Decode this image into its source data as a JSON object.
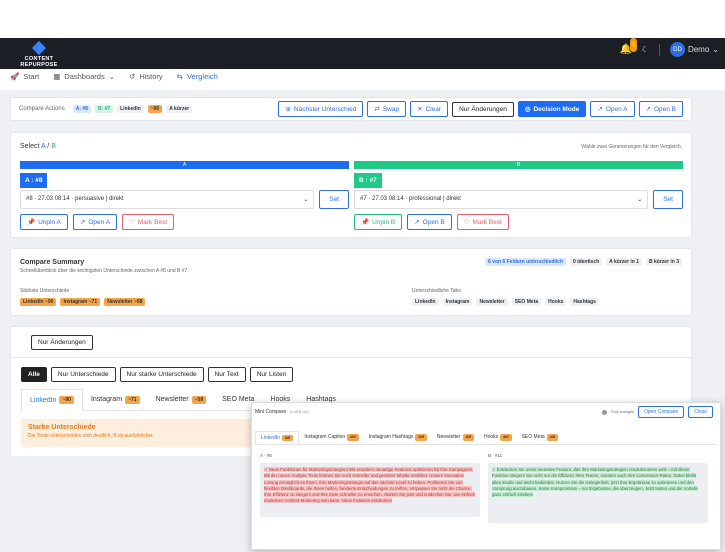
{
  "topbar": {
    "logo": "CONTENT REPURPOSE",
    "bell_count": "1",
    "avatar": "DD",
    "user": "Demo"
  },
  "nav": [
    {
      "label": "Start"
    },
    {
      "label": "Dashboards"
    },
    {
      "label": "History"
    },
    {
      "label": "Vergleich"
    }
  ],
  "actions": {
    "label": "Compare Actions",
    "a": "A: #8",
    "b": "B: #7",
    "channel": "LinkedIn",
    "score": "~90",
    "shorter": "A kürzer",
    "buttons": {
      "next": "Nächster Unterschied",
      "swap": "Swap",
      "clear": "Clear",
      "only_changes": "Nur Änderungen",
      "decision": "Decision Mode",
      "open_a": "Open A",
      "open_b": "Open B"
    }
  },
  "select": {
    "title_prefix": "Select",
    "title_a": "A",
    "title_sep": "/",
    "title_b": "B",
    "hint": "Wähle zwei Generierungen für den Vergleich.",
    "a": {
      "bar": "A",
      "tag": "A : #8",
      "value": "#8 · 27.03 08:14 · persuasive | direkt",
      "set": "Set",
      "unpin": "Unpin A",
      "open": "Open A",
      "mark": "Mark Best"
    },
    "b": {
      "bar": "B",
      "tag": "B : #7",
      "value": "#7 · 27.03 08:14 · professional | direkt",
      "set": "Set",
      "unpin": "Unpin B",
      "open": "Open B",
      "mark": "Mark Best"
    }
  },
  "summary": {
    "title": "Compare Summary",
    "subtitle": "Schnellüberblick über die wichtigsten Unterschiede zwischen A #8 und B #7.",
    "badges": [
      "6 von 6 Feldern unterschiedlich",
      "0 identisch",
      "A kürzer in 1",
      "B kürzer in 3"
    ],
    "strong_label": "Stärkste Unterschiede",
    "strong": [
      {
        "name": "LinkedIn",
        "score": "~90"
      },
      {
        "name": "Instagram",
        "score": "~71"
      },
      {
        "name": "Newsletter",
        "score": "~58"
      }
    ],
    "tabs_label": "Unterschiedliche Tabs",
    "tabs": [
      "LinkedIn",
      "Instagram",
      "Newsletter",
      "SEO Meta",
      "Hooks",
      "Hashtags"
    ]
  },
  "filters": {
    "only_changes": "Nur Änderungen",
    "all": "Alle",
    "diffs": "Nur Unterschiede",
    "strong": "Nur starke Unterschiede",
    "text": "Nur Text",
    "lists": "Nur Listen"
  },
  "tabs": [
    {
      "label": "LinkedIn",
      "score": "~90"
    },
    {
      "label": "Instagram",
      "score": "~71"
    },
    {
      "label": "Newsletter",
      "score": "~58"
    },
    {
      "label": "SEO Meta",
      "score": ""
    },
    {
      "label": "Hooks",
      "score": ""
    },
    {
      "label": "Hashtags",
      "score": ""
    }
  ],
  "notice": {
    "title": "Starke Unterschiede",
    "text": "Die Texte unterscheiden sich deutlich. B ist ausführlicher."
  },
  "mini": {
    "title": "Mini Compare",
    "subtitle": "A: #8  B: #11",
    "only_changes": "Only changes",
    "open": "Open Compare",
    "close": "Close",
    "tabs": [
      {
        "label": "LinkedIn",
        "score": "diff"
      },
      {
        "label": "Instagram Caption",
        "score": "diff"
      },
      {
        "label": "Instagram Hashtags",
        "score": "diff"
      },
      {
        "label": "Newsletter",
        "score": "diff"
      },
      {
        "label": "Hooks",
        "score": "diff"
      },
      {
        "label": "SEO Meta",
        "score": "diff"
      }
    ],
    "a_label": "A · #8",
    "b_label": "B · #11",
    "a_text": "✓ Neue Funktionen für Marketingstrategien! Wir erweitern neuartige Features optimieren für Ihre Kampagnen. Mit der neuen Analyse-Tools können Sie noch schneller und gezielter Inhalte erstellen. Unsere Innovative Lösung ermöglicht es Ihnen, Ihre Marketingstrategie auf das nächste Level zu heben. Profitieren Sie von flexiblen Dashboards, die Ihnen helfen, fundierte Entscheidungen zu treffen. Verpassen Sie nicht die Chance, Ihre Effizienz zu steigern und Ihre Ziele schneller zu erreichen. Starten Sie jetzt und entdecken Sie, wie einfach modernes Content-Marketing sein kann. Neue Features entdecken!",
    "b_text": "✓ Entdecken Sie unser neuestes Feature, das Ihre Marketingstrategien revolutionieren wird – mit dieser Funktion steigern Sie nicht nur die Effizienz Ihrer Teams, sondern auch Ihre Conversion-Raten. Dabei bleibt alles intuitiv und leicht bedienbar. Nutzen Sie die Gelegenheit, jetzt Ihre Ergebnisse zu optimieren und den Vorsprung auszubauen. Keine Kompromisse – nur Ergebnisse, die überzeugen. Jetzt testen und die Vorteile ganz einfach erleben!"
  }
}
